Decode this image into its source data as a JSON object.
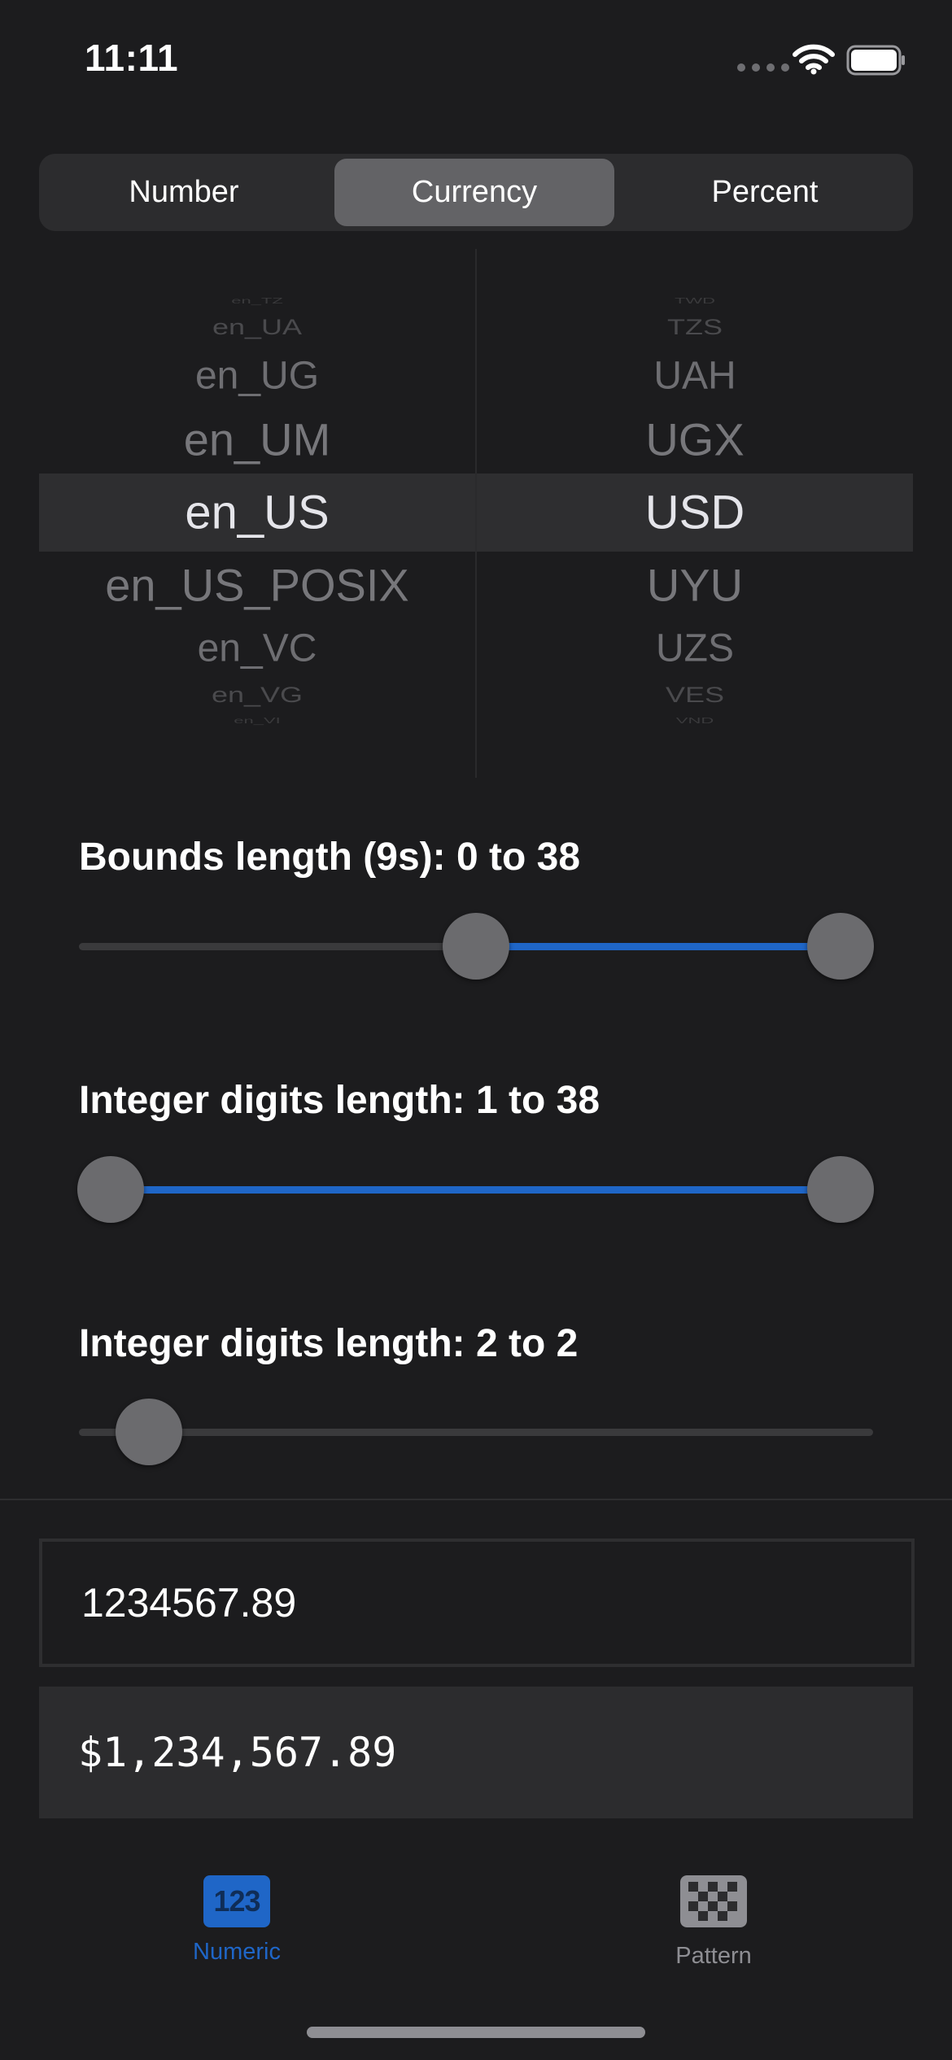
{
  "status_bar": {
    "time": "11:11"
  },
  "segmented": {
    "options": [
      "Number",
      "Currency",
      "Percent"
    ],
    "selected": "Currency"
  },
  "picker": {
    "locales": [
      "en_TZ",
      "en_UA",
      "en_UG",
      "en_UM",
      "en_US",
      "en_US_POSIX",
      "en_VC",
      "en_VG",
      "en_VI"
    ],
    "currencies": [
      "TWD",
      "TZS",
      "UAH",
      "UGX",
      "USD",
      "UYU",
      "UZS",
      "VES",
      "VND"
    ],
    "selected_locale": "en_US",
    "selected_currency": "USD"
  },
  "sliders": [
    {
      "label": "Bounds length (9s): 0 to 38",
      "low_fraction": 0.5,
      "high_fraction": 1.0
    },
    {
      "label": "Integer digits length: 1 to 38",
      "low_fraction": 0.0,
      "high_fraction": 1.0
    },
    {
      "label": "Integer digits length: 2 to 2",
      "value_fraction": 0.05
    }
  ],
  "input": {
    "value": "1234567.89"
  },
  "output": {
    "value": "$1,234,567.89"
  },
  "tabbar": {
    "tabs": [
      {
        "label": "Numeric",
        "icon_text": "123",
        "icon": "numeric-icon",
        "selected": true
      },
      {
        "label": "Pattern",
        "icon": "checkerboard-icon",
        "selected": false
      }
    ]
  },
  "colors": {
    "accent": "#1f66c7",
    "background": "#1c1c1e",
    "segment_active": "#636366"
  }
}
